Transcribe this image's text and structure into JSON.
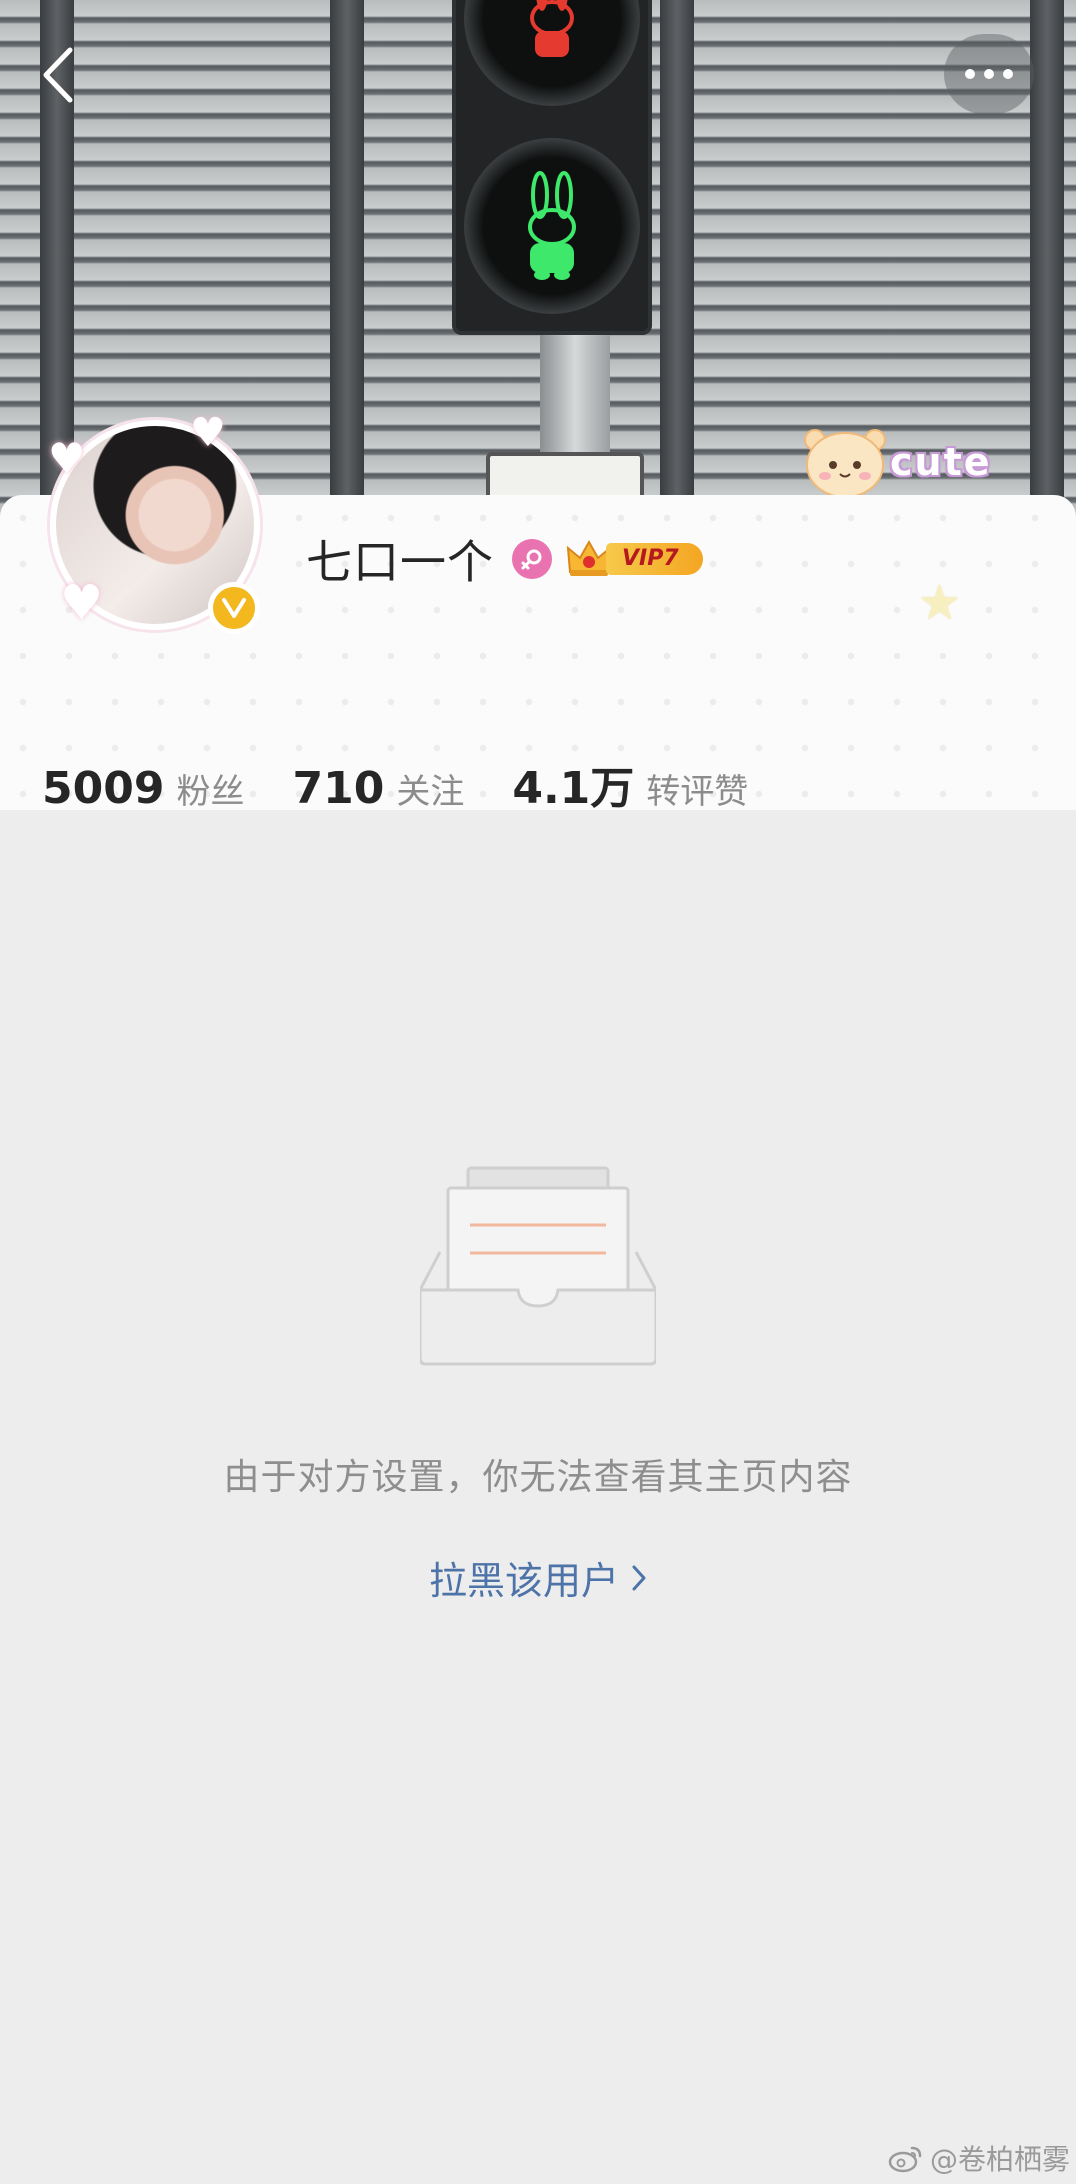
{
  "profile": {
    "name": "七口一个",
    "vip_label": "VIP7",
    "verified_badge": "V"
  },
  "stats": [
    {
      "value": "5009",
      "label": "粉丝"
    },
    {
      "value": "710",
      "label": "关注"
    },
    {
      "value": "4.1万",
      "label": "转评赞"
    }
  ],
  "cover": {
    "sticker_text": "cute"
  },
  "empty_state": {
    "message": "由于对方设置，你无法查看其主页内容",
    "action_label": "拉黑该用户"
  },
  "watermark": {
    "text": "@卷柏栖雾"
  },
  "icons": {
    "back": "chevron-left-icon",
    "more": "more-icon",
    "gender": "female-icon",
    "vip": "crown-icon",
    "empty": "empty-box-icon",
    "action_chevron": "chevron-right-icon"
  },
  "colors": {
    "link": "#4d73a8",
    "vip_gold": "#f4a623",
    "gender_pink": "#e873b0",
    "verified_gold": "#f3b81e",
    "background": "#ededed"
  }
}
